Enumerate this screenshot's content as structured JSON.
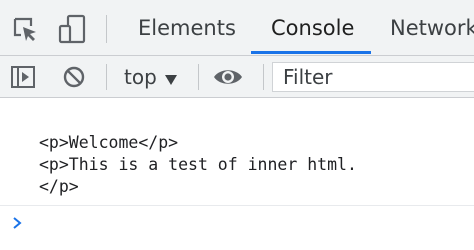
{
  "tabbar": {
    "tabs": [
      {
        "label": "Elements"
      },
      {
        "label": "Console"
      },
      {
        "label": "Network"
      }
    ],
    "active_tab": "Console",
    "accent_color": "#1a73e8",
    "icons": [
      "inspect-element-icon",
      "device-toolbar-icon"
    ]
  },
  "toolbar": {
    "icons": [
      "show-sidebar-icon",
      "clear-console-icon",
      "live-expression-eye-icon"
    ],
    "context": {
      "selected": "top"
    },
    "filter": {
      "placeholder": "Filter",
      "value": ""
    }
  },
  "console": {
    "lines": [
      "<p>Welcome</p>",
      "<p>This is a test of inner html.",
      "</p>"
    ],
    "prompt_symbol": "chevron-right-icon",
    "prompt_color": "#1a73e8"
  }
}
